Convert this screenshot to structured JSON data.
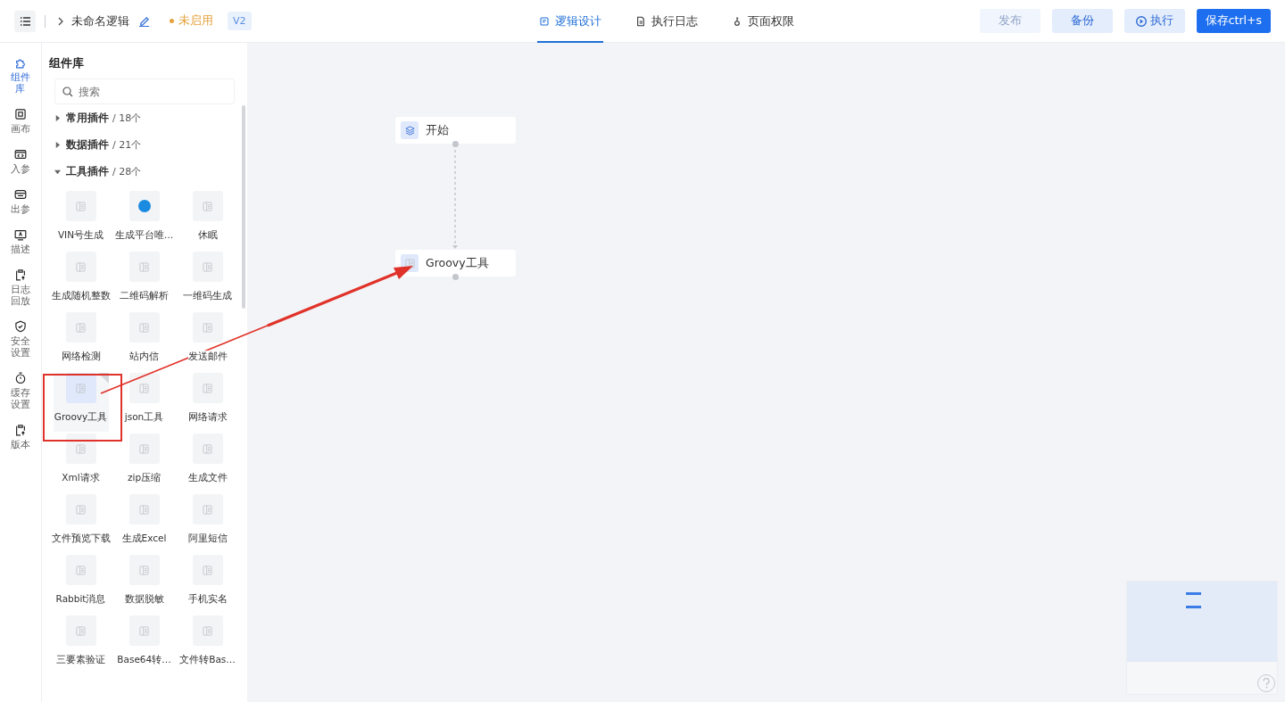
{
  "header": {
    "title": "未命名逻辑",
    "status": {
      "label": "未启用",
      "color": "#e6a23c"
    },
    "version": "V2"
  },
  "tabs": [
    {
      "label": "逻辑设计",
      "selected": true
    },
    {
      "label": "执行日志",
      "selected": false
    },
    {
      "label": "页面权限",
      "selected": false
    }
  ],
  "actions": [
    {
      "label": "发布",
      "kind": "plain",
      "disabled": true
    },
    {
      "label": "备份",
      "kind": "plain",
      "disabled": false
    },
    {
      "label": "执行",
      "kind": "play",
      "disabled": false
    },
    {
      "label": "保存ctrl+s",
      "kind": "primary",
      "disabled": false
    }
  ],
  "rail": [
    {
      "label": "组件库",
      "selected": true
    },
    {
      "label": "画布",
      "selected": false
    },
    {
      "label": "入参",
      "selected": false
    },
    {
      "label": "出参",
      "selected": false
    },
    {
      "label": "描述",
      "selected": false
    },
    {
      "label": "日志回放",
      "selected": false
    },
    {
      "label": "安全设置",
      "selected": false
    },
    {
      "label": "缓存设置",
      "selected": false
    },
    {
      "label": "版本",
      "selected": false
    }
  ],
  "library": {
    "title": "组件库",
    "search": {
      "placeholder": "搜索"
    },
    "categories": [
      {
        "name": "常用插件",
        "count": "/ 18个",
        "expanded": false
      },
      {
        "name": "数据插件",
        "count": "/ 21个",
        "expanded": false
      },
      {
        "name": "工具插件",
        "count": "/ 28个",
        "expanded": true,
        "items": [
          {
            "label": "VIN号生成",
            "kind": "doc",
            "selected": false
          },
          {
            "label": "生成平台唯…",
            "kind": "dot",
            "selected": false
          },
          {
            "label": "休眠",
            "kind": "doc",
            "selected": false
          },
          {
            "label": "生成随机整数",
            "kind": "doc",
            "selected": false
          },
          {
            "label": "二维码解析",
            "kind": "doc",
            "selected": false
          },
          {
            "label": "一维码生成",
            "kind": "doc",
            "selected": false
          },
          {
            "label": "网络检测",
            "kind": "doc",
            "selected": false
          },
          {
            "label": "站内信",
            "kind": "doc",
            "selected": false
          },
          {
            "label": "发送邮件",
            "kind": "doc",
            "selected": false
          },
          {
            "label": "Groovy工具",
            "kind": "doc",
            "selected": true
          },
          {
            "label": "json工具",
            "kind": "doc",
            "selected": false
          },
          {
            "label": "网络请求",
            "kind": "doc",
            "selected": false
          },
          {
            "label": "Xml请求",
            "kind": "doc",
            "selected": false
          },
          {
            "label": "zip压缩",
            "kind": "doc",
            "selected": false
          },
          {
            "label": "生成文件",
            "kind": "doc",
            "selected": false
          },
          {
            "label": "文件预览下载",
            "kind": "doc",
            "selected": false
          },
          {
            "label": "生成Excel",
            "kind": "doc",
            "selected": false
          },
          {
            "label": "阿里短信",
            "kind": "doc",
            "selected": false
          },
          {
            "label": "Rabbit消息",
            "kind": "doc",
            "selected": false
          },
          {
            "label": "数据脱敏",
            "kind": "doc",
            "selected": false
          },
          {
            "label": "手机实名",
            "kind": "doc",
            "selected": false
          },
          {
            "label": "三要素验证",
            "kind": "doc",
            "selected": false
          },
          {
            "label": "Base64转…",
            "kind": "doc",
            "selected": false
          },
          {
            "label": "文件转Bas…",
            "kind": "doc",
            "selected": false
          }
        ]
      }
    ]
  },
  "canvas": {
    "nodes": [
      {
        "label": "开始",
        "kind": "start"
      },
      {
        "label": "Groovy工具",
        "kind": "plugin"
      }
    ]
  }
}
